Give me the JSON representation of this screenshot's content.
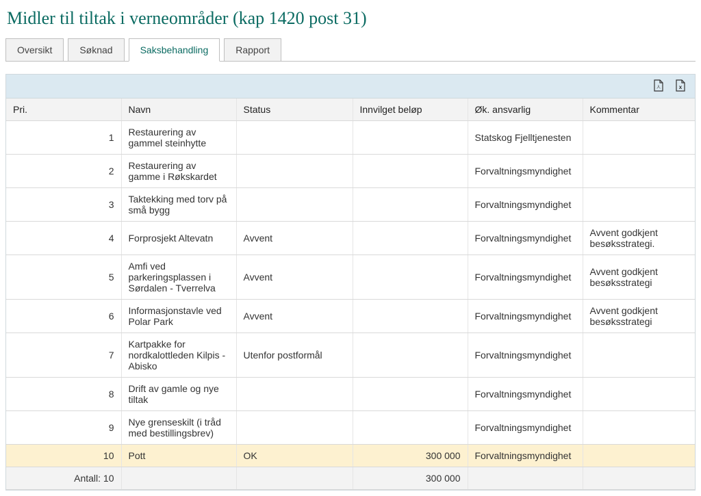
{
  "page_title": "Midler til tiltak i verneområder (kap 1420 post 31)",
  "tabs": [
    {
      "label": "Oversikt",
      "active": false
    },
    {
      "label": "Søknad",
      "active": false
    },
    {
      "label": "Saksbehandling",
      "active": true
    },
    {
      "label": "Rapport",
      "active": false
    }
  ],
  "columns": {
    "pri": "Pri.",
    "navn": "Navn",
    "status": "Status",
    "belop": "Innvilget beløp",
    "ok": "Øk. ansvarlig",
    "kommentar": "Kommentar"
  },
  "rows": [
    {
      "pri": "1",
      "navn": "Restaurering av gammel steinhytte",
      "status": "",
      "belop": "",
      "ok": "Statskog Fjelltjenesten",
      "kommentar": "",
      "highlight": false
    },
    {
      "pri": "2",
      "navn": "Restaurering av gamme i Røkskardet",
      "status": "",
      "belop": "",
      "ok": "Forvaltningsmyndighet",
      "kommentar": "",
      "highlight": false
    },
    {
      "pri": "3",
      "navn": "Taktekking med torv på små bygg",
      "status": "",
      "belop": "",
      "ok": "Forvaltningsmyndighet",
      "kommentar": "",
      "highlight": false
    },
    {
      "pri": "4",
      "navn": "Forprosjekt Altevatn",
      "status": "Avvent",
      "belop": "",
      "ok": "Forvaltningsmyndighet",
      "kommentar": "Avvent godkjent besøksstrategi.",
      "highlight": false
    },
    {
      "pri": "5",
      "navn": "Amfi ved parkeringsplassen i Sørdalen - Tverrelva",
      "status": "Avvent",
      "belop": "",
      "ok": "Forvaltningsmyndighet",
      "kommentar": "Avvent godkjent besøksstrategi",
      "highlight": false
    },
    {
      "pri": "6",
      "navn": "Informasjonstavle ved Polar Park",
      "status": "Avvent",
      "belop": "",
      "ok": "Forvaltningsmyndighet",
      "kommentar": "Avvent godkjent besøksstrategi",
      "highlight": false
    },
    {
      "pri": "7",
      "navn": "Kartpakke for nordkalottleden Kilpis - Abisko",
      "status": "Utenfor postformål",
      "belop": "",
      "ok": "Forvaltningsmyndighet",
      "kommentar": "",
      "highlight": false
    },
    {
      "pri": "8",
      "navn": "Drift av gamle og nye tiltak",
      "status": "",
      "belop": "",
      "ok": "Forvaltningsmyndighet",
      "kommentar": "",
      "highlight": false
    },
    {
      "pri": "9",
      "navn": "Nye grenseskilt (i tråd med bestillingsbrev)",
      "status": "",
      "belop": "",
      "ok": "Forvaltningsmyndighet",
      "kommentar": "",
      "highlight": false
    },
    {
      "pri": "10",
      "navn": "Pott",
      "status": "OK",
      "belop": "300 000",
      "ok": "Forvaltningsmyndighet",
      "kommentar": "",
      "highlight": true
    }
  ],
  "footer": {
    "label": "Antall: 10",
    "total": "300 000"
  }
}
